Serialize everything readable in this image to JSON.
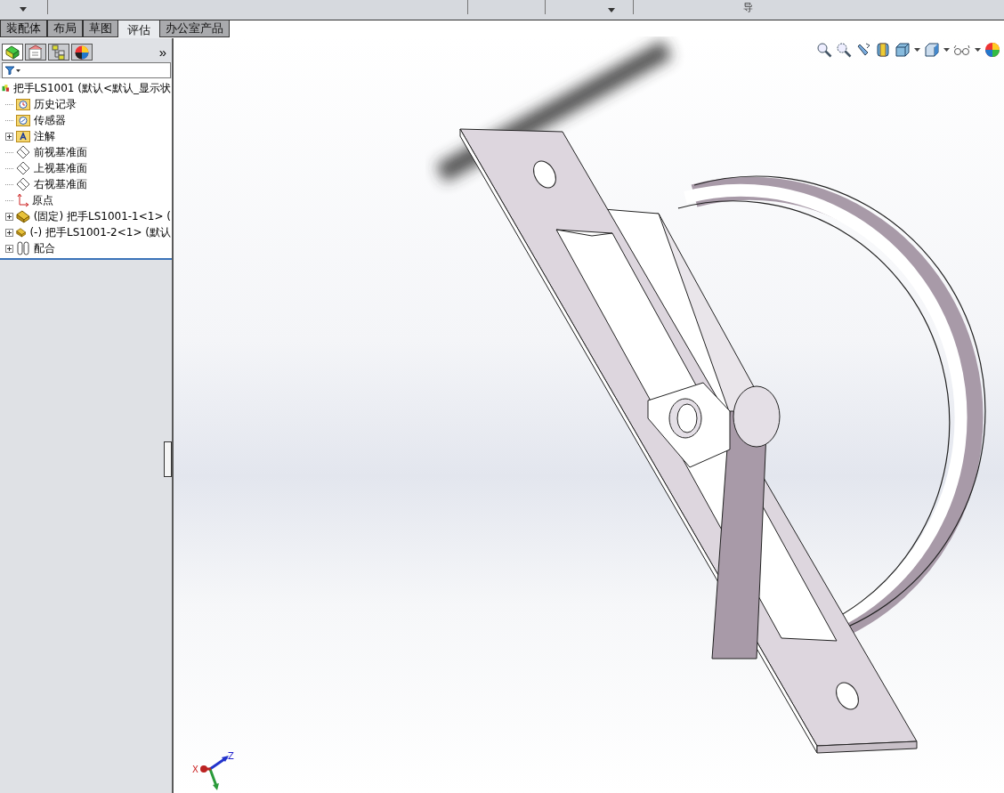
{
  "ribbon": {
    "label_fragment": "导"
  },
  "tabs": [
    {
      "label": "装配体",
      "selected": false
    },
    {
      "label": "布局",
      "selected": false
    },
    {
      "label": "草图",
      "selected": false
    },
    {
      "label": "评估",
      "selected": true
    },
    {
      "label": "办公室产品",
      "selected": false
    }
  ],
  "panel_tabs": [
    {
      "kind": "feature",
      "selected": true
    },
    {
      "kind": "property",
      "selected": false
    },
    {
      "kind": "config",
      "selected": false
    },
    {
      "kind": "display",
      "selected": false
    }
  ],
  "panel_more": "»",
  "tree": {
    "label": "把手LS1001  (默认<默认_显示状",
    "kind": "assembly",
    "children": [
      {
        "label": "历史记录",
        "kind": "history",
        "expandable": false
      },
      {
        "label": "传感器",
        "kind": "sensor",
        "expandable": false
      },
      {
        "label": "注解",
        "kind": "annotation",
        "expandable": true
      },
      {
        "label": "前视基准面",
        "kind": "plane",
        "expandable": false
      },
      {
        "label": "上视基准面",
        "kind": "plane",
        "expandable": false
      },
      {
        "label": "右视基准面",
        "kind": "plane",
        "expandable": false
      },
      {
        "label": "原点",
        "kind": "origin",
        "expandable": false
      },
      {
        "label": "(固定) 把手LS1001-1<1> (",
        "kind": "component",
        "expandable": true
      },
      {
        "label": "(-) 把手LS1001-2<1> (默认",
        "kind": "component",
        "expandable": true
      },
      {
        "label": "配合",
        "kind": "mates",
        "expandable": true
      }
    ]
  },
  "triad": {
    "x": "X",
    "z": "Z"
  }
}
